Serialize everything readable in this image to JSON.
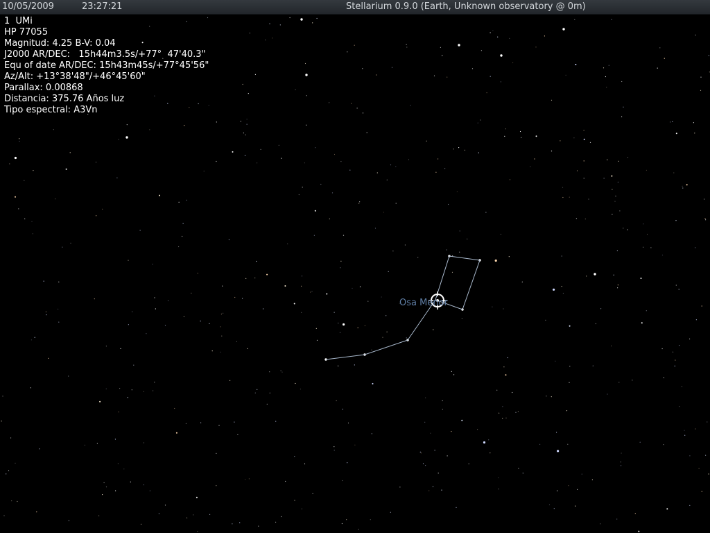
{
  "topbar": {
    "date": "10/05/2009",
    "time": "23:27:21",
    "title": "Stellarium 0.9.0 (Earth, Unknown observatory @ 0m)"
  },
  "object_info": {
    "name": "1  UMi",
    "catalog_id": "HP 77055",
    "magnitude": "Magnitud: 4.25 B-V: 0.04",
    "j2000": "J2000 AR/DEC:   15h44m3.5s/+77°  47'40.3\"",
    "equ_of_date": "Equ of date AR/DEC: 15h43m45s/+77°45'56\"",
    "az_alt": "Az/Alt: +13°38'48\"/+46°45'60\"",
    "parallax": "Parallax: 0.00868",
    "distance": "Distancia: 375.76 Años luz",
    "spectral_type": "Tipo espectral: A3Vn"
  },
  "constellation": {
    "name": "Osa Menor"
  },
  "colors": {
    "sky": "#000000",
    "constellation_line": "#a9b9cd",
    "constellation_label": "#5f7ea5",
    "selection_marker": "#ffffff"
  }
}
